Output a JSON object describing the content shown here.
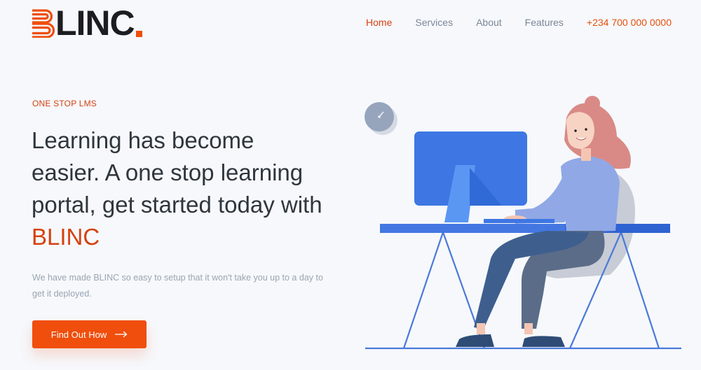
{
  "brand": {
    "logo_text": "LINC",
    "logo_icon": "striped-b-icon",
    "accent": "#f04e0c"
  },
  "nav": {
    "items": [
      {
        "label": "Home",
        "active": true
      },
      {
        "label": "Services",
        "active": false
      },
      {
        "label": "About",
        "active": false
      },
      {
        "label": "Features",
        "active": false
      }
    ],
    "phone": "+234 700 000 0000"
  },
  "hero": {
    "eyebrow": "ONE STOP LMS",
    "headline": "Learning has become easier. A one stop learning portal, get started today with",
    "headline_brand": "BLINC",
    "description": "We have made BLINC so easy to setup that it won't take you up to a day to get it deployed.",
    "cta_label": "Find Out How",
    "cta_icon": "arrow-right-icon"
  },
  "illustration": {
    "subject": "woman-at-computer-desk-illustration"
  }
}
